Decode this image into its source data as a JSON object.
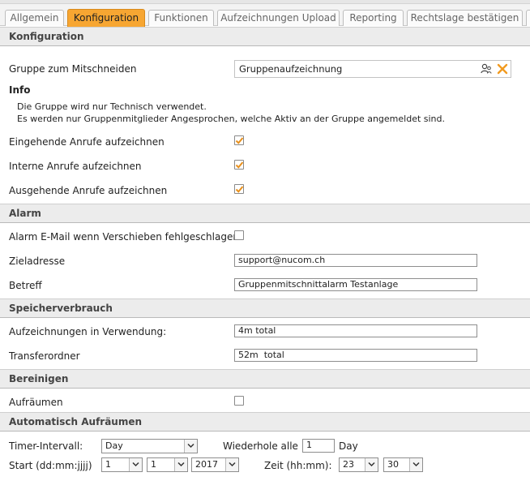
{
  "tabs": [
    {
      "label": "Allgemein",
      "active": false
    },
    {
      "label": "Konfiguration",
      "active": true
    },
    {
      "label": "Funktionen",
      "active": false
    },
    {
      "label": "Aufzeichnungen Upload",
      "active": false
    },
    {
      "label": "Reporting",
      "active": false
    },
    {
      "label": "Rechtslage bestätigen",
      "active": false
    }
  ],
  "konfiguration": {
    "section_title": "Konfiguration",
    "group_label": "Gruppe zum Mitschneiden",
    "group_value": "Gruppenaufzeichnung",
    "info_title": "Info",
    "info_line1": "Die Gruppe wird nur Technisch verwendet.",
    "info_line2": "Es werden nur Gruppenmitglieder Angesprochen, welche Aktiv an der Gruppe angemeldet sind.",
    "incoming_label": "Eingehende Anrufe aufzeichnen",
    "incoming_checked": true,
    "internal_label": "Interne Anrufe aufzeichnen",
    "internal_checked": true,
    "outgoing_label": "Ausgehende Anrufe aufzeichnen",
    "outgoing_checked": true
  },
  "alarm": {
    "section_title": "Alarm",
    "email_label": "Alarm E-Mail wenn Verschieben fehlgeschlagen",
    "email_checked": false,
    "target_label": "Zieladresse",
    "target_value": "support@nucom.ch",
    "subject_label": "Betreff",
    "subject_value": "Gruppenmitschnittalarm Testanlage"
  },
  "speicher": {
    "section_title": "Speicherverbrauch",
    "used_label": "Aufzeichnungen in Verwendung:",
    "used_value": "4m total",
    "transfer_label": "Transferordner",
    "transfer_value": "52m  total"
  },
  "bereinigen": {
    "section_title": "Bereinigen",
    "cleanup_label": "Aufräumen",
    "cleanup_checked": false
  },
  "auto": {
    "section_title": "Automatisch Aufräumen",
    "timer_label": "Timer-Intervall:",
    "timer_value": "Day",
    "repeat_label": "Wiederhole alle",
    "repeat_value": "1",
    "repeat_unit": "Day",
    "start_label": "Start (dd:mm:jjjj)",
    "start_day": "1",
    "start_month": "1",
    "start_year": "2017",
    "time_label": "Zeit (hh:mm):",
    "time_hour": "23",
    "time_minute": "30"
  },
  "colors": {
    "active_tab": "#f7a632",
    "check_orange": "#e8901c",
    "clear_orange": "#f29a1f"
  }
}
